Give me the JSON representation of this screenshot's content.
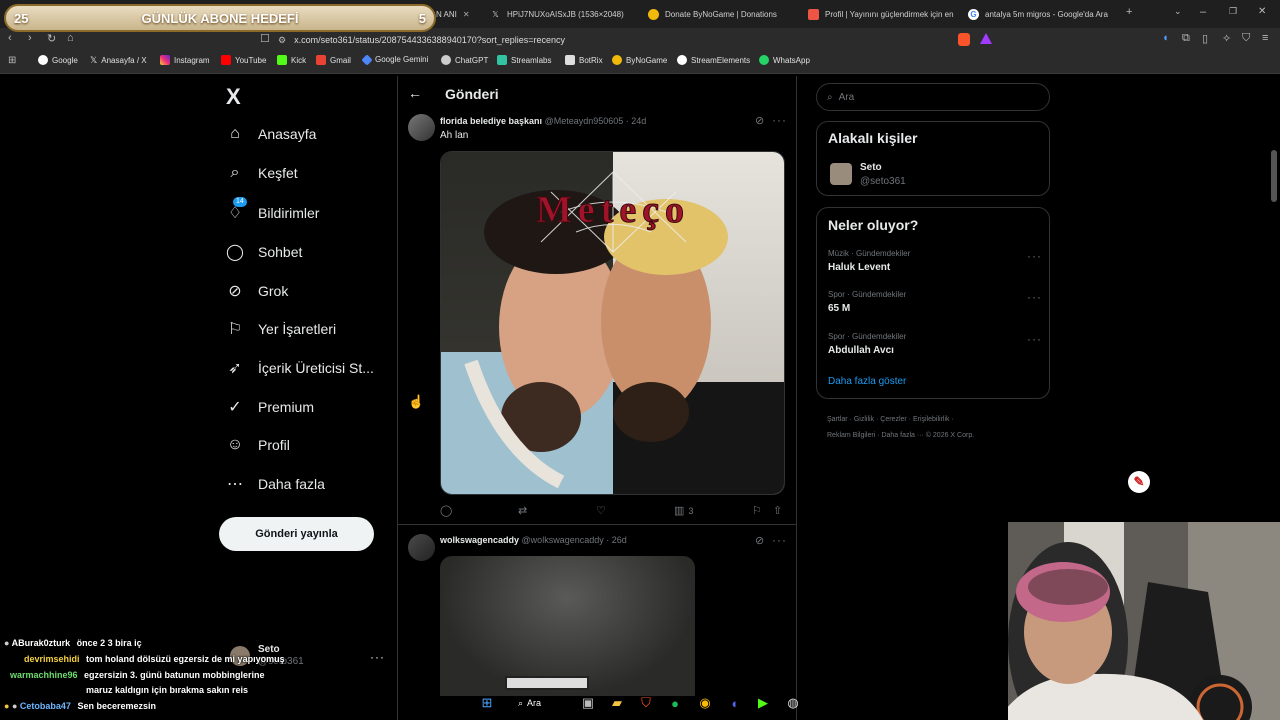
{
  "browser": {
    "tabs": [
      {
        "label": "N ANI",
        "active": true
      },
      {
        "label": "HPiJ7NUXoAISxJB (1536×2048)"
      },
      {
        "label": "Donate ByNoGame | Donations"
      },
      {
        "label": "Profil | Yayınını güçlendirmek için en"
      },
      {
        "label": "antalya 5m migros - Google'da Ara"
      }
    ],
    "url": "x.com/seto361/status/2087544336388940170?sort_replies=recency",
    "bookmarks": [
      "Google",
      "Anasayfa / X",
      "Instagram",
      "YouTube",
      "Kick",
      "Gmail",
      "Google Gemini",
      "ChatGPT",
      "Streamlabs",
      "BotRix",
      "ByNoGame",
      "StreamElements",
      "WhatsApp"
    ]
  },
  "overlay": {
    "goal_title": "GÜNLÜK ABONE HEDEFİ",
    "goal_current": "25",
    "goal_target": "5"
  },
  "sidebar": {
    "logo": "X",
    "items": [
      {
        "label": "Anasayfa",
        "icon": "home-icon"
      },
      {
        "label": "Keşfet",
        "icon": "search-icon"
      },
      {
        "label": "Bildirimler",
        "icon": "bell-icon",
        "badge": "14"
      },
      {
        "label": "Sohbet",
        "icon": "chat-icon"
      },
      {
        "label": "Grok",
        "icon": "grok-icon"
      },
      {
        "label": "Yer İşaretleri",
        "icon": "bookmark-icon"
      },
      {
        "label": "İçerik Üreticisi St...",
        "icon": "rocket-icon"
      },
      {
        "label": "Premium",
        "icon": "verified-icon"
      },
      {
        "label": "Profil",
        "icon": "user-icon"
      },
      {
        "label": "Daha fazla",
        "icon": "more-circle-icon"
      }
    ],
    "post_button": "Gönderi yayınla",
    "account_name": "Seto",
    "account_handle": "@seto361"
  },
  "main": {
    "header_title": "Gönderi",
    "posts": [
      {
        "author": "florida belediye başkanı",
        "handle": "@Meteaydn950605",
        "time": "24d",
        "text": "Ah lan",
        "image_text": "Meteço",
        "views": "3"
      },
      {
        "author": "wolkswagencaddy",
        "handle": "@wolkswagencaddy",
        "time": "26d"
      }
    ]
  },
  "right": {
    "search_placeholder": "Ara",
    "related_title": "Alakalı kişiler",
    "related_name": "Seto",
    "related_handle": "@seto361",
    "trends_title": "Neler oluyor?",
    "trends": [
      {
        "category": "Müzik · Gündemdekiler",
        "name": "Haluk Levent"
      },
      {
        "category": "Spor · Gündemdekiler",
        "name": "65 M"
      },
      {
        "category": "Spor · Gündemdekiler",
        "name": "Abdullah Avcı"
      }
    ],
    "show_more": "Daha fazla göster",
    "footer_line1": "Şartlar · Gizlilik · Çerezler · Erişilebilirlik ·",
    "footer_line2": "Reklam Bilgileri · Daha fazla ··· © 2026 X Corp."
  },
  "chat": [
    {
      "user": "ABurak0zturk",
      "message": "önce 2 3 bira iç",
      "color": "#ffffff"
    },
    {
      "user": "devrimsehidi",
      "message": "tom holand dölsüzü egzersiz de mi yapıyomuş",
      "color": "#f4d03f"
    },
    {
      "user": "warmachhine96",
      "message": "egzersizin 3. günü batunun mobbinglerine",
      "color": "#6fdc6f"
    },
    {
      "user": "",
      "message": "maruz kaldıgın için bırakma sakın reis",
      "color": "#ffffff"
    },
    {
      "user": "Cetobaba47",
      "message": "Sen beceremezsin",
      "color": "#6fb6ff"
    }
  ],
  "taskbar": {
    "search_label": "Ara"
  },
  "colors": {
    "accent": "#1d9bf0",
    "bg": "#000000",
    "border": "#2f3336"
  }
}
